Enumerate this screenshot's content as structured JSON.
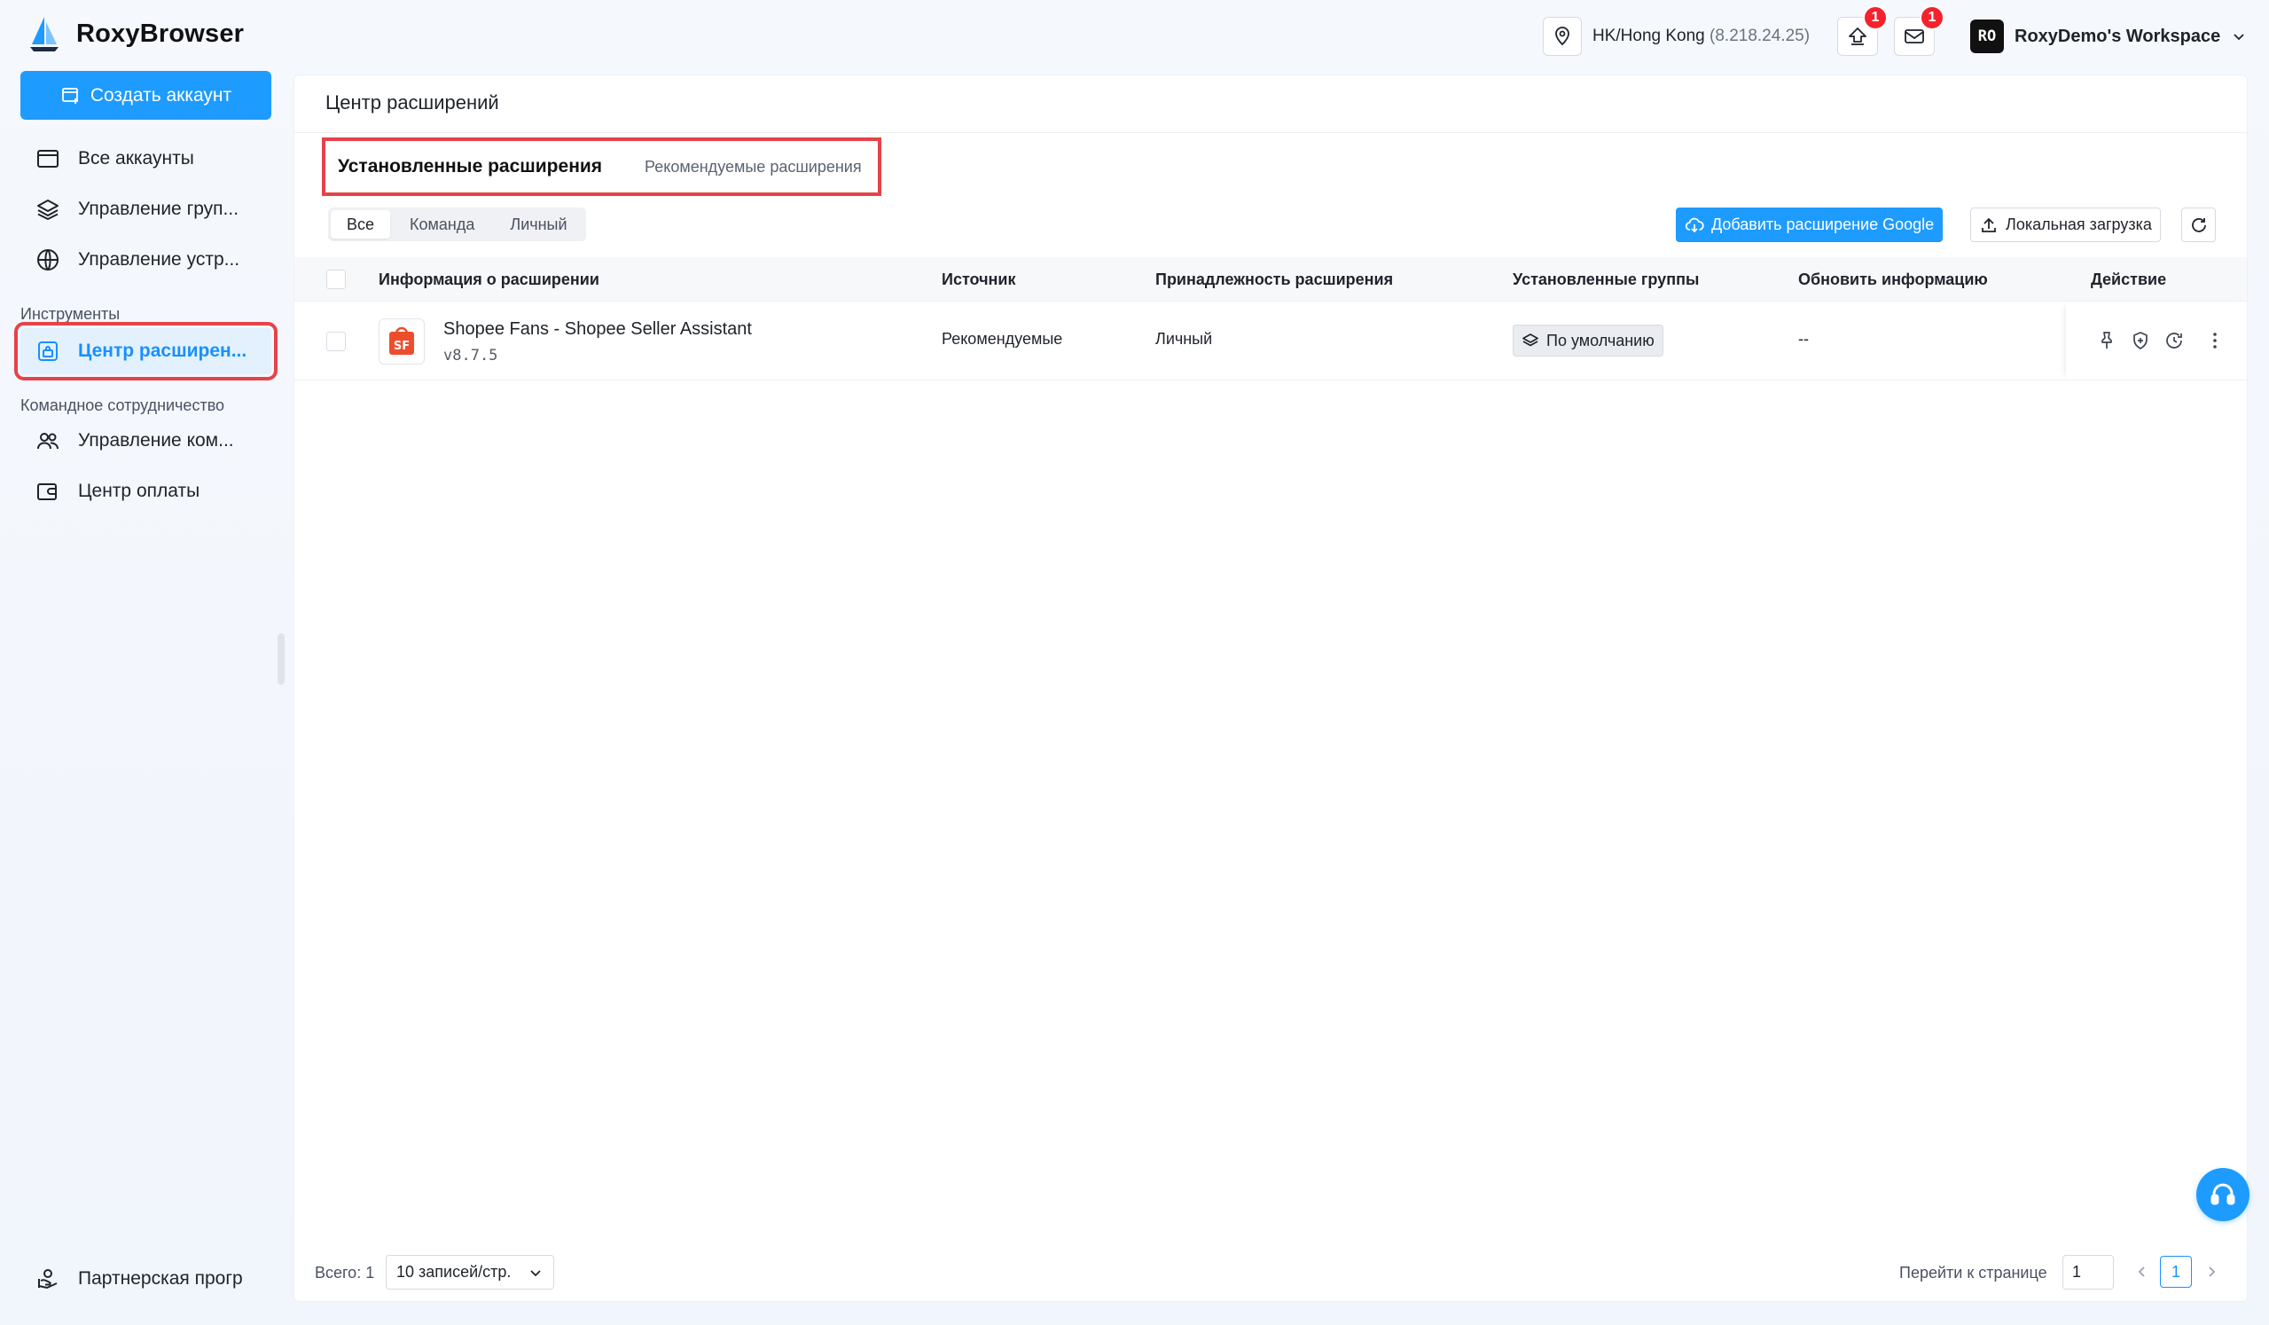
{
  "app": {
    "name": "RoxyBrowser"
  },
  "sidebar": {
    "create_button": "Создать аккаунт",
    "items": [
      {
        "label": "Все аккаунты"
      },
      {
        "label": "Управление груп..."
      },
      {
        "label": "Управление устр..."
      }
    ],
    "section_tools": "Инструменты",
    "tools_items": [
      {
        "label": "Центр расширен..."
      }
    ],
    "section_team": "Командное сотрудничество",
    "team_items": [
      {
        "label": "Управление ком..."
      },
      {
        "label": "Центр оплаты"
      }
    ],
    "bottom_item": "Партнерская прогр"
  },
  "topbar": {
    "location_city": "HK/Hong Kong",
    "location_ip": "(8.218.24.25)",
    "upload_badge": "1",
    "mail_badge": "1",
    "workspace_avatar": "RO",
    "workspace_name": "RoxyDemo's Workspace"
  },
  "main": {
    "title": "Центр расширений",
    "tabs": [
      {
        "label": "Установленные расширения",
        "active": true
      },
      {
        "label": "Рекомендуемые расширения",
        "active": false
      }
    ],
    "filters": [
      {
        "label": "Все"
      },
      {
        "label": "Команда"
      },
      {
        "label": "Личный"
      }
    ],
    "add_google_button": "Добавить расширение Google",
    "local_upload_button": "Локальная загрузка",
    "table": {
      "columns": [
        "Информация о расширении",
        "Источник",
        "Принадлежность расширения",
        "Установленные группы",
        "Обновить информацию",
        "Действие"
      ],
      "rows": [
        {
          "name": "Shopee Fans - Shopee Seller Assistant",
          "version": "v8.7.5",
          "source": "Рекомендуемые",
          "ownership": "Личный",
          "group": "По умолчанию",
          "update_info": "--"
        }
      ]
    },
    "footer": {
      "total": "Всего: 1",
      "page_size": "10 записей/стр.",
      "goto_label": "Перейти к странице",
      "goto_value": "1",
      "current_page": "1"
    }
  },
  "colors": {
    "accent": "#1e9bff",
    "highlight": "#e5434a",
    "badge": "#f5222d"
  }
}
